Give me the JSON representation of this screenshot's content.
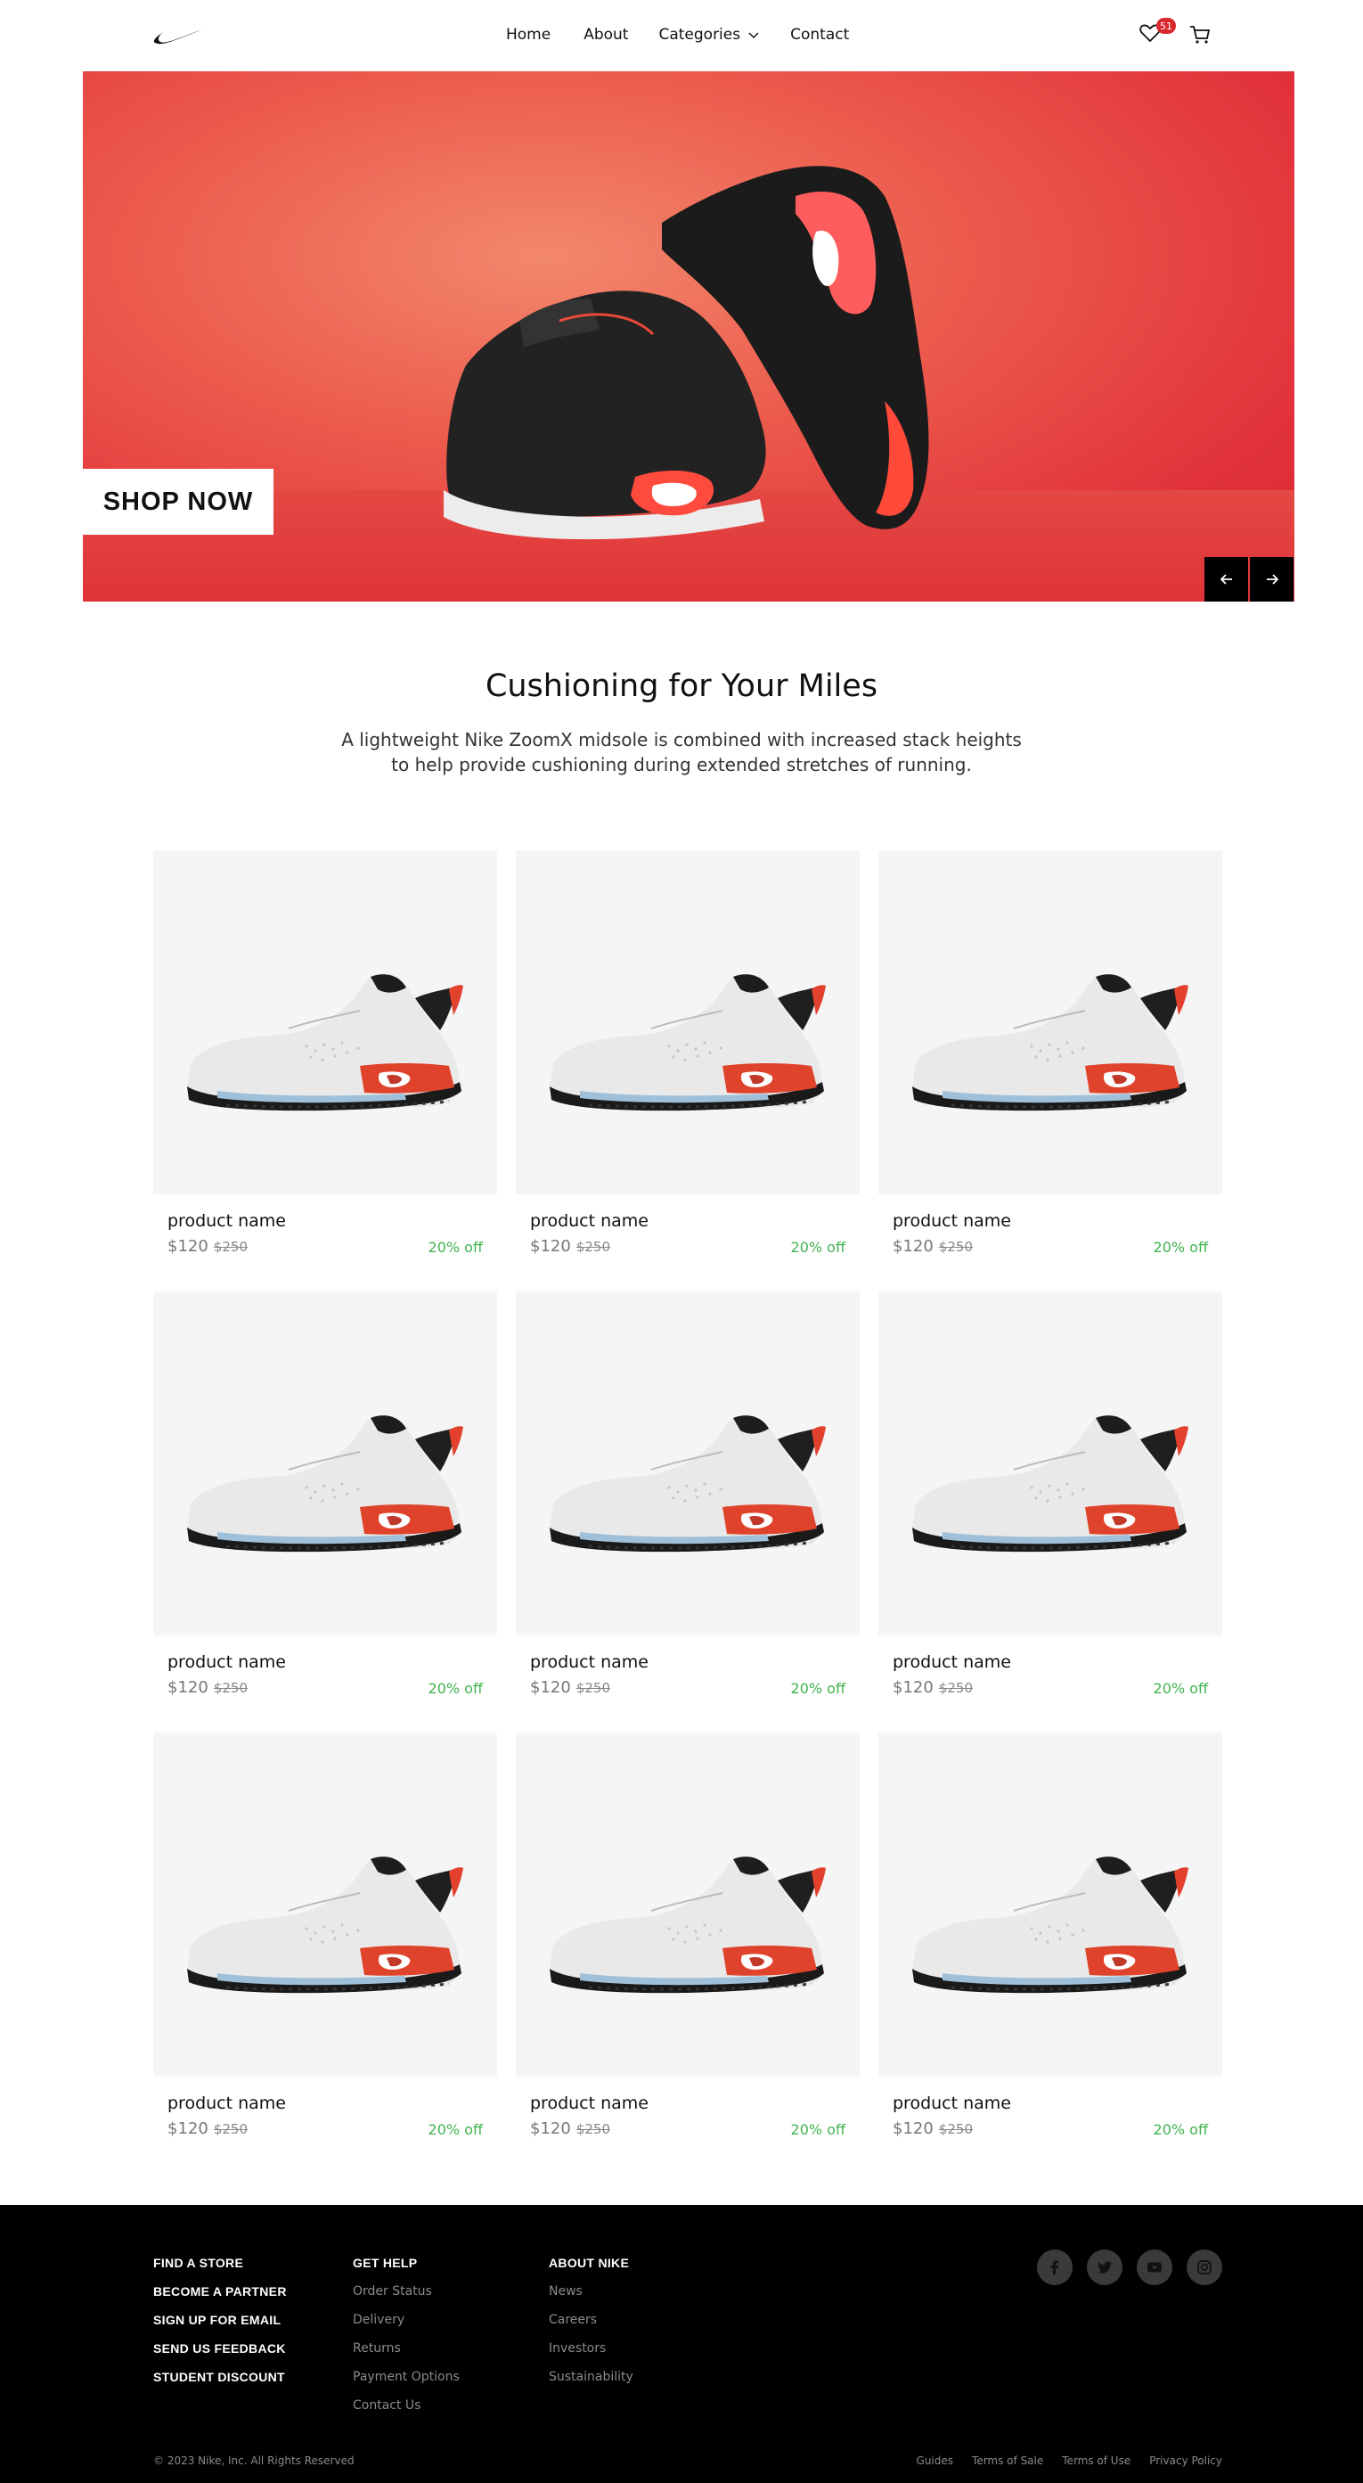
{
  "nav": {
    "logo_icon": "swoosh-logo",
    "links": [
      "Home",
      "About",
      "Categories",
      "Contact"
    ],
    "wishlist_count": "51",
    "wishlist_icon": "heart-icon",
    "cart_icon": "cart-icon"
  },
  "hero": {
    "cta_label": "SHOP NOW",
    "prev_icon": "arrow-left-icon",
    "next_icon": "arrow-right-icon",
    "background_color": "#e2343b"
  },
  "section": {
    "title": "Cushioning for Your Miles",
    "description": "A lightweight Nike ZoomX midsole is combined with increased stack heights to help provide cushioning during extended stretches of running."
  },
  "products": [
    {
      "name": "product name",
      "price": "$120",
      "old_price": "$250",
      "discount": "20% off"
    },
    {
      "name": "product name",
      "price": "$120",
      "old_price": "$250",
      "discount": "20% off"
    },
    {
      "name": "product name",
      "price": "$120",
      "old_price": "$250",
      "discount": "20% off"
    },
    {
      "name": "product name",
      "price": "$120",
      "old_price": "$250",
      "discount": "20% off"
    },
    {
      "name": "product name",
      "price": "$120",
      "old_price": "$250",
      "discount": "20% off"
    },
    {
      "name": "product name",
      "price": "$120",
      "old_price": "$250",
      "discount": "20% off"
    },
    {
      "name": "product name",
      "price": "$120",
      "old_price": "$250",
      "discount": "20% off"
    },
    {
      "name": "product name",
      "price": "$120",
      "old_price": "$250",
      "discount": "20% off"
    },
    {
      "name": "product name",
      "price": "$120",
      "old_price": "$250",
      "discount": "20% off"
    }
  ],
  "footer": {
    "col1": [
      "FIND A STORE",
      "BECOME A PARTNER",
      "SIGN UP FOR EMAIL",
      "SEND US FEEDBACK",
      "STUDENT DISCOUNT"
    ],
    "get_help": {
      "heading": "GET HELP",
      "links": [
        "Order Status",
        "Delivery",
        "Returns",
        "Payment Options",
        "Contact Us"
      ]
    },
    "about": {
      "heading": "ABOUT NIKE",
      "links": [
        "News",
        "Careers",
        "Investors",
        "Sustainability"
      ]
    },
    "social_icons": [
      "facebook-icon",
      "twitter-icon",
      "youtube-icon",
      "instagram-icon"
    ],
    "copyright": "© 2023 Nike, Inc. All Rights Reserved",
    "legal_links": [
      "Guides",
      "Terms of Sale",
      "Terms of Use",
      "Privacy Policy"
    ]
  },
  "colors": {
    "accent_red": "#d9282d",
    "discount_green": "#3fb34f",
    "footer_bg": "#000000"
  }
}
